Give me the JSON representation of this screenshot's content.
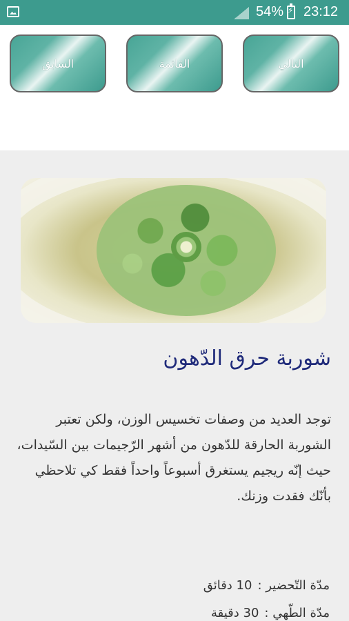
{
  "status_bar": {
    "battery": "54%",
    "time": "23:12",
    "icons": [
      "gallery-notification-icon",
      "signal-icon",
      "battery-charging-icon"
    ]
  },
  "nav": {
    "next_label": "التالي",
    "list_label": "القائمة",
    "prev_label": "السابق"
  },
  "recipe": {
    "title": "شوربة حرق الدّهون",
    "description": "توجد العديد من وصفات تخسيس الوزن، ولكن تعتبر الشوربة الحارقة للدّهون من أشهر الرّجيمات بين السّيدات، حيث إنّه ريجيم يستغرق أسبوعاً واحداً فقط كي تلاحظي بأنّك فقدت وزنك.",
    "prep_label": "مدّة التّحضير :",
    "prep_value": "10 دقائق",
    "cook_label": "مدّة الطّهي :",
    "cook_value": "30 دقيقة"
  },
  "colors": {
    "accent": "#3d9b8e",
    "title": "#1f2a7a",
    "content_bg": "#eeeeee"
  }
}
